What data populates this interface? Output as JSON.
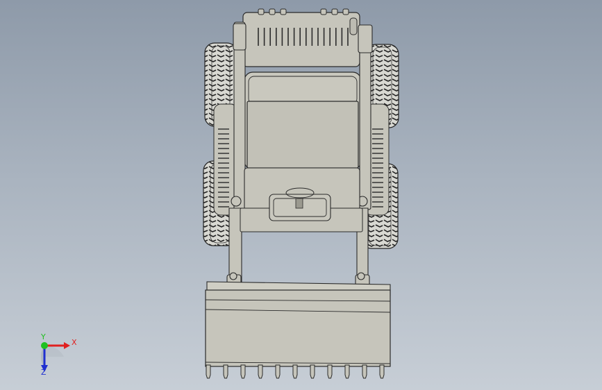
{
  "viewport": {
    "background_top": "#8e9aa9",
    "background_bottom": "#c7ced6"
  },
  "model": {
    "body_color": "#c6c5bb",
    "edge_color": "#2a2a2a",
    "tire_color": "#d8d8d2"
  },
  "triad": {
    "x_label": "X",
    "y_label": "Y",
    "z_label": "Z",
    "x_color": "#e02020",
    "y_color": "#20c020",
    "z_color": "#2030d0"
  }
}
